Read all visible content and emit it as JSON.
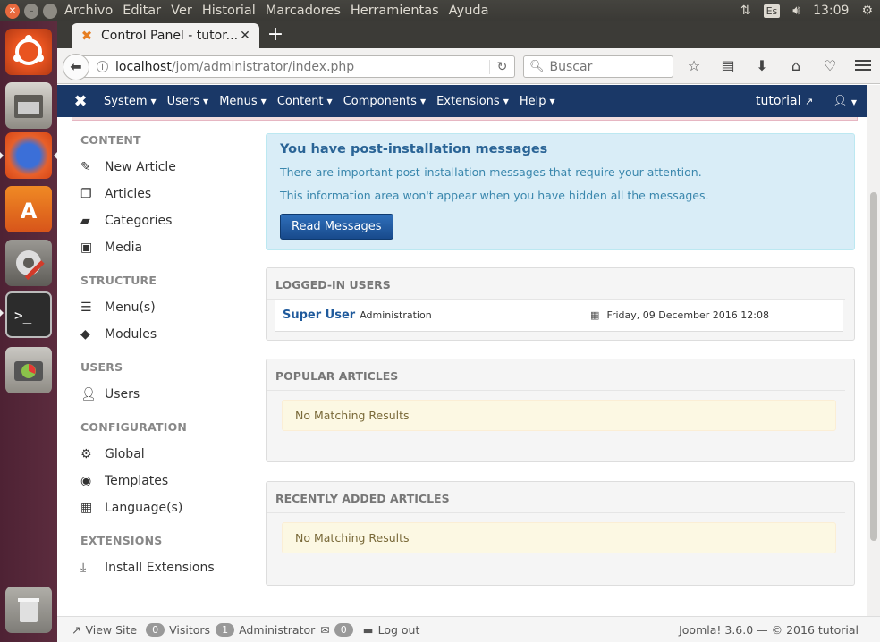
{
  "os_panel": {
    "menus": [
      "Archivo",
      "Editar",
      "Ver",
      "Historial",
      "Marcadores",
      "Herramientas",
      "Ayuda"
    ],
    "keyboard_layout": "Es",
    "time": "13:09"
  },
  "browser": {
    "tab_title": "Control Panel - tutor...",
    "url_host": "localhost",
    "url_path": "/jom/administrator/index.php",
    "search_placeholder": "Buscar"
  },
  "joomla_nav": {
    "items": [
      "System",
      "Users",
      "Menus",
      "Content",
      "Components",
      "Extensions",
      "Help"
    ],
    "site_name": "tutorial"
  },
  "sidebar": {
    "sections": [
      {
        "heading": "CONTENT",
        "items": [
          {
            "label": "New Article",
            "icon": "pencil-icon"
          },
          {
            "label": "Articles",
            "icon": "stack-icon"
          },
          {
            "label": "Categories",
            "icon": "folder-icon"
          },
          {
            "label": "Media",
            "icon": "image-icon"
          }
        ]
      },
      {
        "heading": "STRUCTURE",
        "items": [
          {
            "label": "Menu(s)",
            "icon": "list-icon"
          },
          {
            "label": "Modules",
            "icon": "cube-icon"
          }
        ]
      },
      {
        "heading": "USERS",
        "items": [
          {
            "label": "Users",
            "icon": "users-icon"
          }
        ]
      },
      {
        "heading": "CONFIGURATION",
        "items": [
          {
            "label": "Global",
            "icon": "gear-icon"
          },
          {
            "label": "Templates",
            "icon": "eye-icon"
          },
          {
            "label": "Language(s)",
            "icon": "comments-icon"
          }
        ]
      },
      {
        "heading": "EXTENSIONS",
        "items": [
          {
            "label": "Install Extensions",
            "icon": "download-icon"
          }
        ]
      }
    ]
  },
  "post_install": {
    "title": "You have post-installation messages",
    "text1": "There are important post-installation messages that require your attention.",
    "text2": "This information area won't appear when you have hidden all the messages.",
    "button": "Read Messages"
  },
  "logged_in": {
    "heading": "LOGGED-IN USERS",
    "user": "Super User",
    "role": "Administration",
    "date": "Friday, 09 December 2016 12:08"
  },
  "popular": {
    "heading": "POPULAR ARTICLES",
    "message": "No Matching Results"
  },
  "recent": {
    "heading": "RECENTLY ADDED ARTICLES",
    "message": "No Matching Results"
  },
  "statusbar": {
    "view_site": "View Site",
    "visitors_count": "0",
    "visitors_label": "Visitors",
    "admin_count": "1",
    "admin_label": "Administrator",
    "messages_count": "0",
    "logout": "Log out",
    "version": "Joomla! 3.6.0 — © 2016 tutorial"
  }
}
